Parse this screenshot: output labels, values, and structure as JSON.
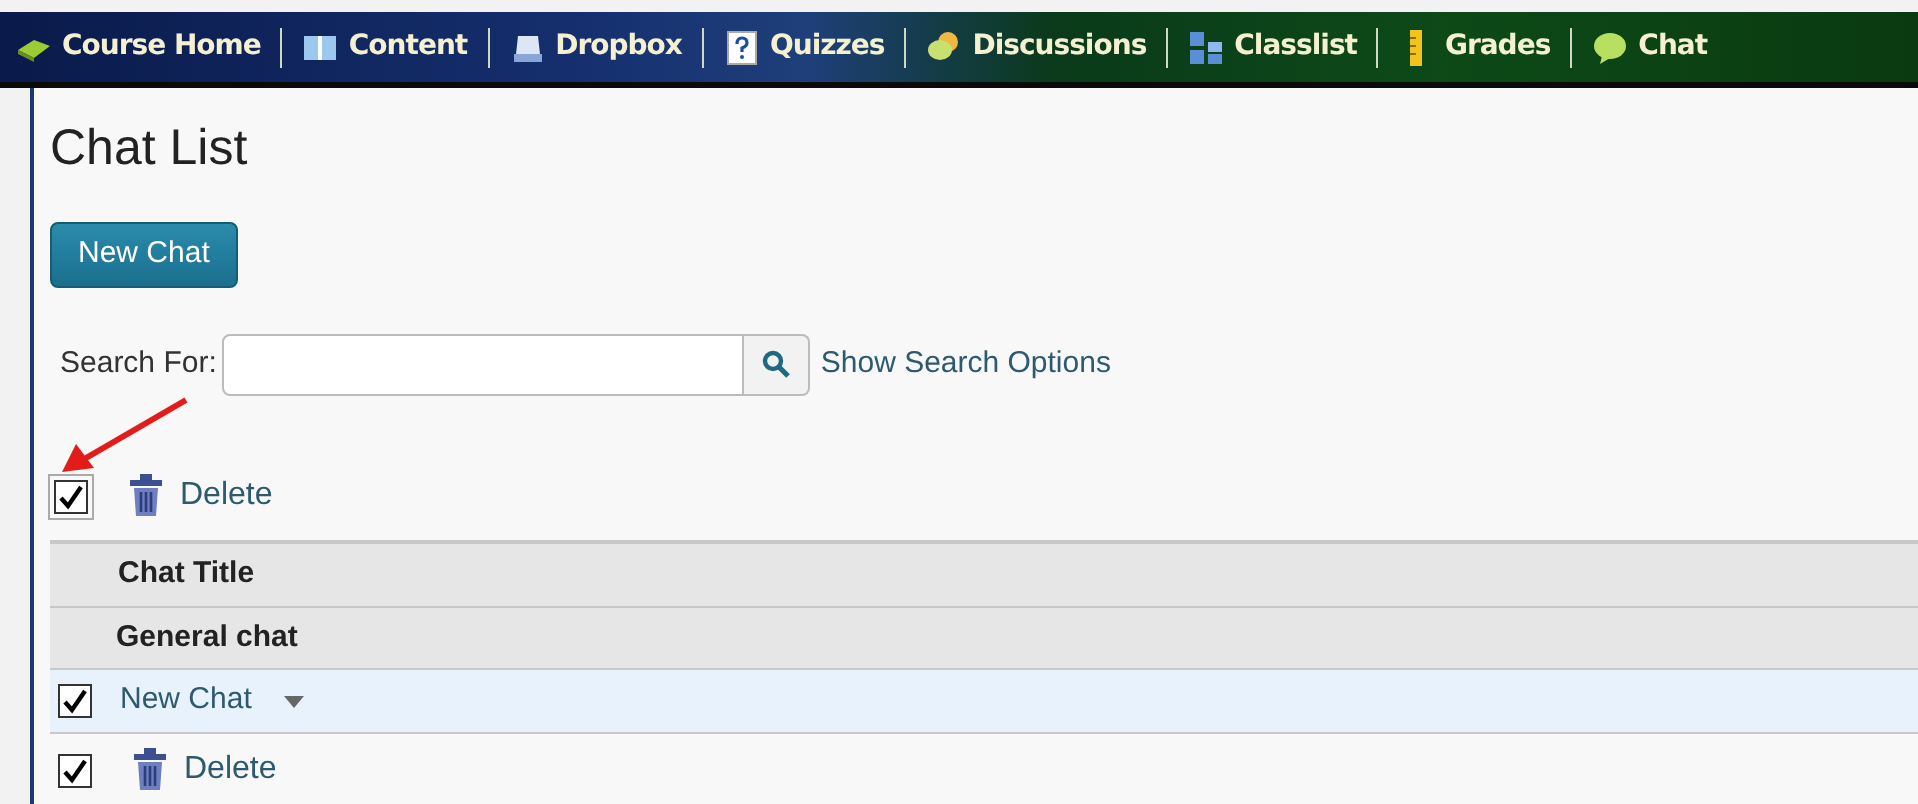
{
  "nav": [
    {
      "label": "Course Home"
    },
    {
      "label": "Content"
    },
    {
      "label": "Dropbox"
    },
    {
      "label": "Quizzes"
    },
    {
      "label": "Discussions"
    },
    {
      "label": "Classlist"
    },
    {
      "label": "Grades"
    },
    {
      "label": "Chat"
    }
  ],
  "page_title": "Chat List",
  "new_button": "New Chat",
  "search": {
    "label": "Search For:",
    "options_link": "Show Search Options"
  },
  "top_actions": {
    "checked": true,
    "delete": "Delete"
  },
  "table": {
    "column": "Chat Title",
    "group": "General chat",
    "rows": [
      {
        "title": "New Chat",
        "checked": true
      }
    ]
  },
  "bottom_actions": {
    "checked": true,
    "delete": "Delete"
  }
}
